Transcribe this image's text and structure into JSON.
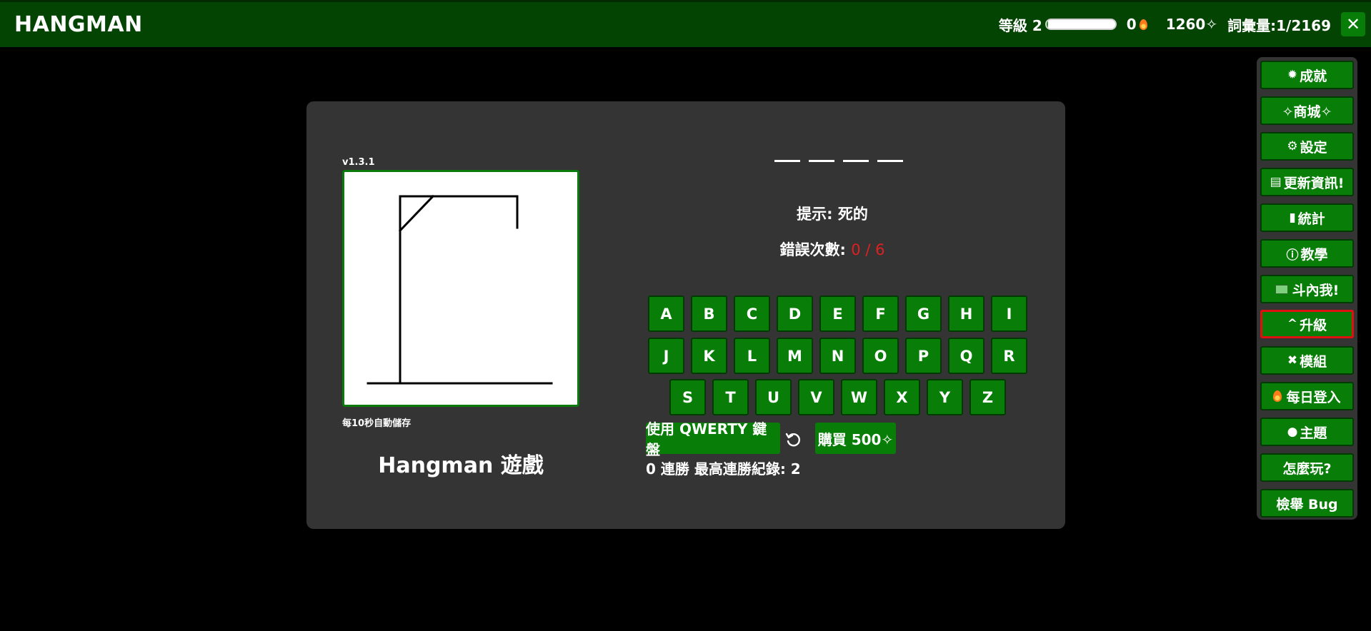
{
  "header": {
    "title": "HANGMAN",
    "level_label": "等級 2",
    "level_progress": 0.02,
    "streak": "0",
    "coins": "1260✧",
    "word_count": "詞彙量:1/2169",
    "close": "✕"
  },
  "game": {
    "version": "v1.3.1",
    "autosave": "每10秒自動儲存",
    "title": "Hangman 遊戲",
    "word_length": 4,
    "hint": "提示: 死的",
    "errors_label": "錯誤次數:",
    "errors_value": "0 / 6",
    "keyboard": {
      "row1": [
        "A",
        "B",
        "C",
        "D",
        "E",
        "F",
        "G",
        "H",
        "I"
      ],
      "row2": [
        "J",
        "K",
        "L",
        "M",
        "N",
        "O",
        "P",
        "Q",
        "R"
      ],
      "row3": [
        "S",
        "T",
        "U",
        "V",
        "W",
        "X",
        "Y",
        "Z"
      ]
    },
    "qwerty_button": "使用 QWERTY 鍵盤",
    "buy_button": "購買 500✧",
    "streak_text": "0 連勝 最高連勝紀錄: 2"
  },
  "sidebar": {
    "achievements": "成就",
    "shop": "✧商城✧",
    "settings": "設定",
    "updates": "更新資訊!",
    "stats": "統計",
    "tutorial": "教學",
    "donate": "斗內我!",
    "upgrade": "升級",
    "mods": "模組",
    "daily": "每日登入",
    "theme": "主題",
    "howto": "怎麼玩?",
    "bug": "檢舉 Bug"
  },
  "colors": {
    "topbar": "#034403",
    "button_green": "#087d08",
    "card": "#343434",
    "error_red": "#e02020",
    "highlight_border": "#e01010"
  }
}
